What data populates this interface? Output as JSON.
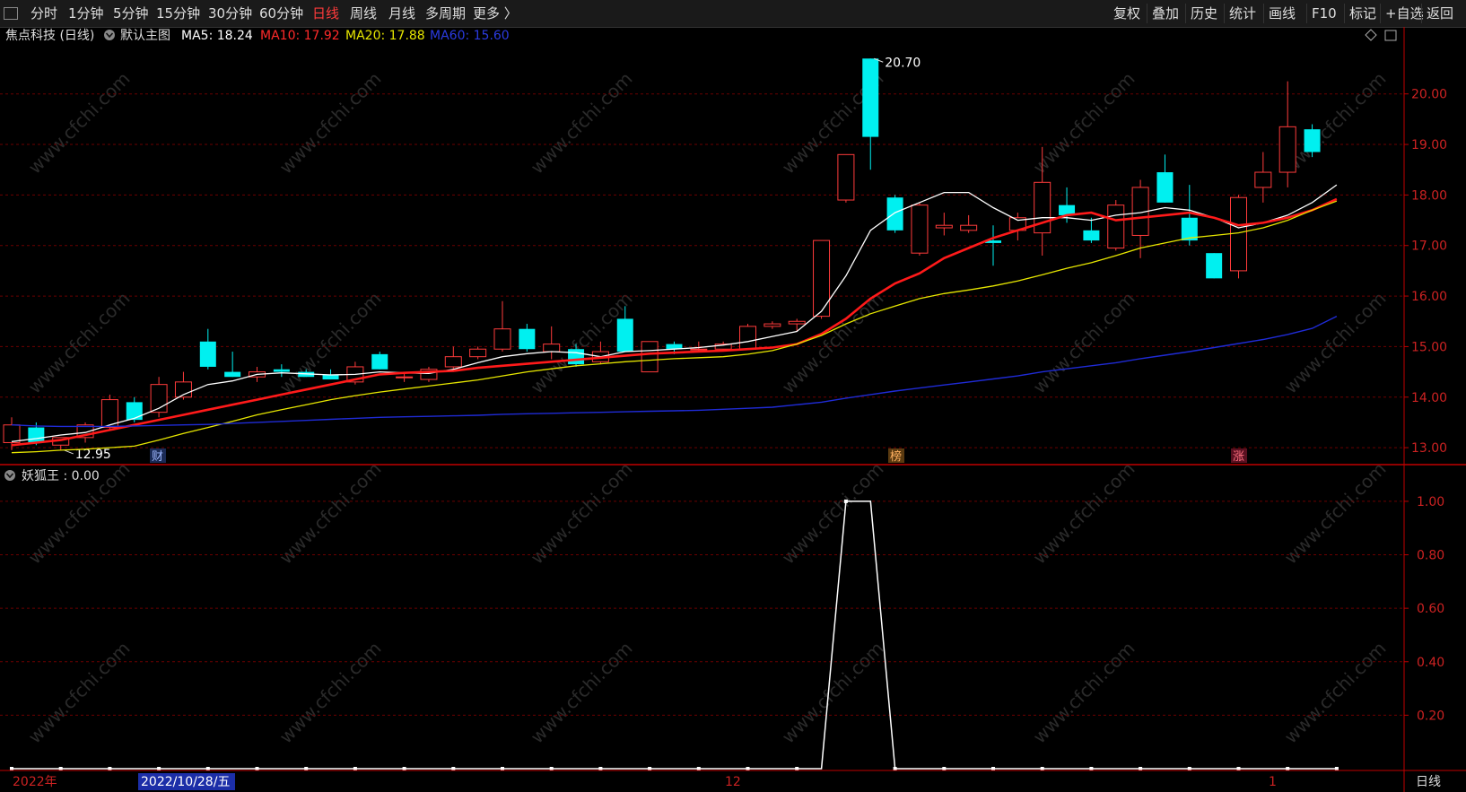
{
  "toolbar": {
    "periods": [
      "分时",
      "1分钟",
      "5分钟",
      "15分钟",
      "30分钟",
      "60分钟",
      "日线",
      "周线",
      "月线",
      "多周期",
      "更多 〉"
    ],
    "active_period": "日线",
    "right_tools": [
      "复权",
      "叠加",
      "历史",
      "统计",
      "画线",
      "F10",
      "标记",
      "+自选",
      "返回"
    ]
  },
  "main_legend": {
    "stock": "焦点科技 (日线)",
    "template": "默认主图",
    "ma5": "MA5: 18.24",
    "ma10": "MA10: 17.92",
    "ma20": "MA20: 17.88",
    "ma60": "MA60: 15.60"
  },
  "colors": {
    "up": "#ff3b3b",
    "down": "#00f0f0",
    "ma5": "#ffffff",
    "ma10": "#ff1a1a",
    "ma20": "#e6e600",
    "ma60": "#1f2bd6",
    "grid": "#6b0000",
    "axis": "#c00000"
  },
  "sub_legend": "妖狐王 : 0.00",
  "watermark": "www.cfchi.com",
  "bottom": {
    "year_label": "2022年",
    "date_label": "2022/10/28/五",
    "month_label": "12",
    "month_label2": "1",
    "period_tag": "日线"
  },
  "markers": {
    "cai": "财",
    "bang": "榜",
    "zhang": "涨"
  },
  "chart_data": [
    {
      "type": "candlestick",
      "title": "焦点科技 (日线)",
      "ylim": [
        12.7,
        20.9
      ],
      "y_ticks": [
        13.0,
        14.0,
        15.0,
        16.0,
        17.0,
        18.0,
        19.0,
        20.0
      ],
      "y_tick_labels": [
        "13.00",
        "14.00",
        "15.00",
        "16.00",
        "17.00",
        "18.00",
        "19.00",
        "20.00"
      ],
      "annotations": [
        {
          "text": "20.70",
          "value": 20.7,
          "index": 35
        },
        {
          "text": "12.95",
          "value": 12.95,
          "index": 2
        }
      ],
      "candles": [
        {
          "o": 13.1,
          "h": 13.6,
          "l": 12.95,
          "c": 13.45
        },
        {
          "o": 13.4,
          "h": 13.5,
          "l": 13.05,
          "c": 13.1
        },
        {
          "o": 13.05,
          "h": 13.2,
          "l": 12.95,
          "c": 13.2
        },
        {
          "o": 13.2,
          "h": 13.5,
          "l": 13.1,
          "c": 13.45
        },
        {
          "o": 13.4,
          "h": 14.05,
          "l": 13.35,
          "c": 13.95
        },
        {
          "o": 13.9,
          "h": 14.0,
          "l": 13.5,
          "c": 13.55
        },
        {
          "o": 13.7,
          "h": 14.4,
          "l": 13.6,
          "c": 14.25
        },
        {
          "o": 14.0,
          "h": 14.5,
          "l": 13.95,
          "c": 14.3
        },
        {
          "o": 15.1,
          "h": 15.35,
          "l": 14.55,
          "c": 14.6
        },
        {
          "o": 14.5,
          "h": 14.9,
          "l": 14.4,
          "c": 14.4
        },
        {
          "o": 14.4,
          "h": 14.6,
          "l": 14.3,
          "c": 14.5
        },
        {
          "o": 14.55,
          "h": 14.65,
          "l": 14.4,
          "c": 14.5
        },
        {
          "o": 14.5,
          "h": 14.55,
          "l": 14.4,
          "c": 14.4
        },
        {
          "o": 14.45,
          "h": 14.55,
          "l": 14.35,
          "c": 14.35
        },
        {
          "o": 14.3,
          "h": 14.7,
          "l": 14.25,
          "c": 14.6
        },
        {
          "o": 14.85,
          "h": 14.9,
          "l": 14.55,
          "c": 14.55
        },
        {
          "o": 14.4,
          "h": 14.5,
          "l": 14.3,
          "c": 14.4
        },
        {
          "o": 14.35,
          "h": 14.6,
          "l": 14.3,
          "c": 14.55
        },
        {
          "o": 14.6,
          "h": 15.0,
          "l": 14.5,
          "c": 14.8
        },
        {
          "o": 14.8,
          "h": 15.0,
          "l": 14.75,
          "c": 14.95
        },
        {
          "o": 14.95,
          "h": 15.9,
          "l": 14.9,
          "c": 15.35
        },
        {
          "o": 15.35,
          "h": 15.45,
          "l": 14.9,
          "c": 14.95
        },
        {
          "o": 14.9,
          "h": 15.4,
          "l": 14.75,
          "c": 15.05
        },
        {
          "o": 14.95,
          "h": 15.05,
          "l": 14.6,
          "c": 14.65
        },
        {
          "o": 14.7,
          "h": 15.1,
          "l": 14.65,
          "c": 14.9
        },
        {
          "o": 15.55,
          "h": 15.8,
          "l": 14.9,
          "c": 14.9
        },
        {
          "o": 14.5,
          "h": 15.1,
          "l": 14.5,
          "c": 15.1
        },
        {
          "o": 15.05,
          "h": 15.1,
          "l": 14.85,
          "c": 14.95
        },
        {
          "o": 14.95,
          "h": 15.1,
          "l": 14.9,
          "c": 14.95
        },
        {
          "o": 14.95,
          "h": 15.1,
          "l": 14.9,
          "c": 15.05
        },
        {
          "o": 14.95,
          "h": 15.45,
          "l": 14.95,
          "c": 15.4
        },
        {
          "o": 15.4,
          "h": 15.5,
          "l": 15.35,
          "c": 15.45
        },
        {
          "o": 15.45,
          "h": 15.55,
          "l": 15.3,
          "c": 15.5
        },
        {
          "o": 15.6,
          "h": 17.1,
          "l": 15.55,
          "c": 17.1
        },
        {
          "o": 17.9,
          "h": 18.8,
          "l": 17.85,
          "c": 18.8
        },
        {
          "o": 20.7,
          "h": 20.7,
          "l": 18.5,
          "c": 19.15
        },
        {
          "o": 17.95,
          "h": 18.0,
          "l": 17.25,
          "c": 17.3
        },
        {
          "o": 16.85,
          "h": 17.85,
          "l": 16.8,
          "c": 17.8
        },
        {
          "o": 17.35,
          "h": 17.65,
          "l": 17.2,
          "c": 17.4
        },
        {
          "o": 17.3,
          "h": 17.6,
          "l": 17.25,
          "c": 17.4
        },
        {
          "o": 17.1,
          "h": 17.4,
          "l": 16.6,
          "c": 17.05
        },
        {
          "o": 17.3,
          "h": 17.65,
          "l": 17.1,
          "c": 17.55
        },
        {
          "o": 17.25,
          "h": 18.95,
          "l": 16.8,
          "c": 18.25
        },
        {
          "o": 17.8,
          "h": 18.15,
          "l": 17.45,
          "c": 17.6
        },
        {
          "o": 17.3,
          "h": 17.55,
          "l": 17.05,
          "c": 17.1
        },
        {
          "o": 16.95,
          "h": 17.9,
          "l": 16.9,
          "c": 17.8
        },
        {
          "o": 17.2,
          "h": 18.3,
          "l": 16.75,
          "c": 18.15
        },
        {
          "o": 18.45,
          "h": 18.8,
          "l": 17.85,
          "c": 17.85
        },
        {
          "o": 17.55,
          "h": 18.2,
          "l": 17.0,
          "c": 17.1
        },
        {
          "o": 16.85,
          "h": 16.85,
          "l": 16.35,
          "c": 16.35
        },
        {
          "o": 16.5,
          "h": 18.0,
          "l": 16.35,
          "c": 17.95
        },
        {
          "o": 18.15,
          "h": 18.85,
          "l": 17.85,
          "c": 18.45
        },
        {
          "o": 18.45,
          "h": 20.25,
          "l": 18.15,
          "c": 19.35
        },
        {
          "o": 19.3,
          "h": 19.4,
          "l": 18.75,
          "c": 18.85
        }
      ],
      "series": [
        {
          "name": "MA5",
          "values": [
            13.12,
            13.18,
            13.25,
            13.3,
            13.45,
            13.58,
            13.78,
            14.05,
            14.25,
            14.32,
            14.45,
            14.48,
            14.46,
            14.44,
            14.45,
            14.5,
            14.48,
            14.47,
            14.55,
            14.68,
            14.8,
            14.86,
            14.9,
            14.88,
            14.8,
            14.9,
            14.92,
            14.95,
            14.98,
            15.03,
            15.1,
            15.2,
            15.3,
            15.7,
            16.4,
            17.3,
            17.65,
            17.85,
            18.05,
            18.05,
            17.75,
            17.5,
            17.55,
            17.55,
            17.5,
            17.6,
            17.65,
            17.75,
            17.7,
            17.55,
            17.35,
            17.45,
            17.6,
            17.85,
            18.2
          ]
        },
        {
          "name": "MA10",
          "values": [
            13.05,
            13.1,
            13.15,
            13.25,
            13.35,
            13.45,
            13.55,
            13.65,
            13.75,
            13.85,
            13.95,
            14.05,
            14.15,
            14.25,
            14.35,
            14.45,
            14.48,
            14.5,
            14.52,
            14.58,
            14.62,
            14.66,
            14.7,
            14.74,
            14.78,
            14.82,
            14.86,
            14.88,
            14.9,
            14.92,
            14.95,
            14.98,
            15.05,
            15.25,
            15.55,
            15.95,
            16.25,
            16.45,
            16.75,
            16.95,
            17.15,
            17.3,
            17.45,
            17.6,
            17.65,
            17.5,
            17.55,
            17.6,
            17.65,
            17.55,
            17.4,
            17.45,
            17.55,
            17.7,
            17.92
          ]
        },
        {
          "name": "MA20",
          "values": [
            12.9,
            12.92,
            12.95,
            12.97,
            13.0,
            13.03,
            13.15,
            13.28,
            13.4,
            13.52,
            13.65,
            13.75,
            13.85,
            13.95,
            14.03,
            14.1,
            14.16,
            14.22,
            14.28,
            14.34,
            14.42,
            14.5,
            14.56,
            14.62,
            14.66,
            14.7,
            14.73,
            14.76,
            14.78,
            14.8,
            14.85,
            14.92,
            15.05,
            15.22,
            15.45,
            15.65,
            15.8,
            15.95,
            16.05,
            16.12,
            16.2,
            16.3,
            16.42,
            16.55,
            16.66,
            16.8,
            16.95,
            17.05,
            17.15,
            17.2,
            17.25,
            17.35,
            17.5,
            17.7,
            17.88
          ]
        },
        {
          "name": "MA60",
          "values": [
            13.45,
            13.43,
            13.42,
            13.42,
            13.42,
            13.43,
            13.44,
            13.45,
            13.46,
            13.48,
            13.5,
            13.52,
            13.54,
            13.56,
            13.58,
            13.6,
            13.61,
            13.62,
            13.63,
            13.64,
            13.66,
            13.67,
            13.68,
            13.69,
            13.7,
            13.71,
            13.72,
            13.73,
            13.74,
            13.76,
            13.78,
            13.8,
            13.85,
            13.9,
            13.98,
            14.05,
            14.12,
            14.18,
            14.24,
            14.3,
            14.36,
            14.42,
            14.5,
            14.56,
            14.62,
            14.68,
            14.76,
            14.83,
            14.9,
            14.98,
            15.06,
            15.14,
            15.24,
            15.36,
            15.6
          ]
        }
      ]
    },
    {
      "type": "line",
      "title": "妖狐王",
      "ylim": [
        0,
        1.05
      ],
      "y_ticks": [
        0.2,
        0.4,
        0.6,
        0.8,
        1.0
      ],
      "y_tick_labels": [
        "0.20",
        "0.40",
        "0.60",
        "0.80",
        "1.00"
      ],
      "series": [
        {
          "name": "妖狐王",
          "values": [
            0,
            0,
            0,
            0,
            0,
            0,
            0,
            0,
            0,
            0,
            0,
            0,
            0,
            0,
            0,
            0,
            0,
            0,
            0,
            0,
            0,
            0,
            0,
            0,
            0,
            0,
            0,
            0,
            0,
            0,
            0,
            0,
            0,
            0,
            1,
            1,
            0,
            0,
            0,
            0,
            0,
            0,
            0,
            0,
            0,
            0,
            0,
            0,
            0,
            0,
            0,
            0,
            0,
            0,
            0
          ]
        }
      ]
    }
  ]
}
